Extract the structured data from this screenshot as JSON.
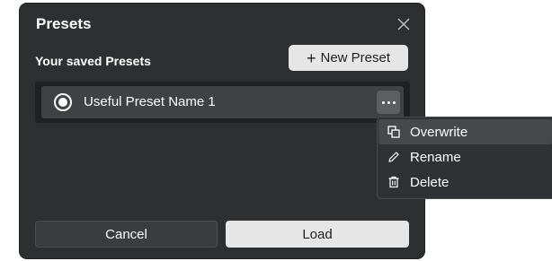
{
  "dialog": {
    "title": "Presets",
    "close_icon": "close-icon",
    "subtitle": "Your saved Presets",
    "new_preset_label": "New Preset",
    "new_preset_icon": "plus-icon"
  },
  "presets": [
    {
      "name": "Useful Preset Name 1",
      "selected": true
    }
  ],
  "context_menu": {
    "items": [
      {
        "label": "Overwrite",
        "icon": "overwrite-icon",
        "highlighted": true
      },
      {
        "label": "Rename",
        "icon": "pencil-icon",
        "highlighted": false
      },
      {
        "label": "Delete",
        "icon": "trash-icon",
        "highlighted": false
      }
    ]
  },
  "footer": {
    "cancel_label": "Cancel",
    "load_label": "Load"
  },
  "colors": {
    "dialog_bg": "#2e2f31",
    "row_bg": "#404145",
    "primary_button_bg": "#e6e6e6",
    "text": "#ffffff"
  }
}
